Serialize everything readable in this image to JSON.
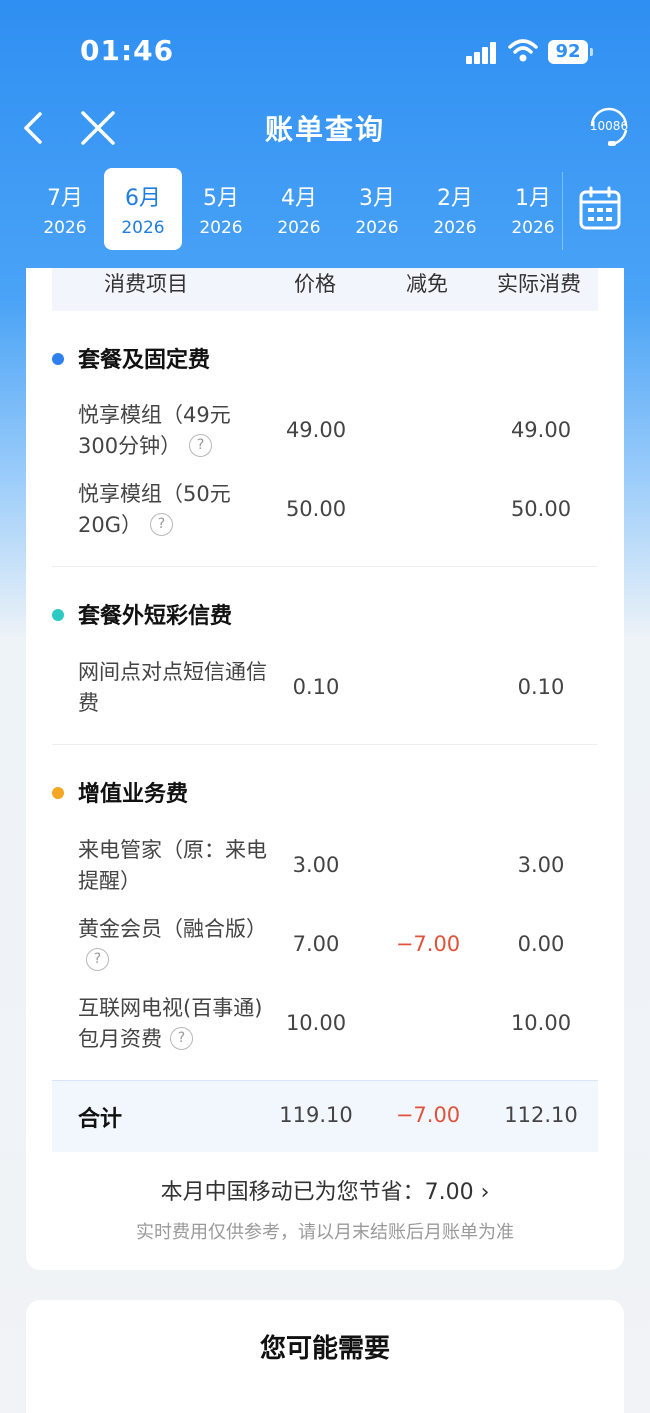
{
  "status_bar": {
    "time": "01:46",
    "battery": "92"
  },
  "header": {
    "title": "账单查询",
    "service_number": "10086"
  },
  "month_tabs": [
    {
      "month": "7月",
      "year": "2026"
    },
    {
      "month": "6月",
      "year": "2026"
    },
    {
      "month": "5月",
      "year": "2026"
    },
    {
      "month": "4月",
      "year": "2026"
    },
    {
      "month": "3月",
      "year": "2026"
    },
    {
      "month": "2月",
      "year": "2026"
    },
    {
      "month": "1月",
      "year": "2026"
    }
  ],
  "table": {
    "headers": {
      "item": "消费项目",
      "price": "价格",
      "discount": "减免",
      "actual": "实际消费"
    },
    "sections": [
      {
        "title": "套餐及固定费",
        "color": "#2f80ed",
        "items": [
          {
            "name": "悦享模组（49元300分钟）",
            "price": "49.00",
            "discount": "",
            "actual": "49.00"
          },
          {
            "name": "悦享模组（50元20G）",
            "price": "50.00",
            "discount": "",
            "actual": "50.00"
          }
        ]
      },
      {
        "title": "套餐外短彩信费",
        "color": "#2ec9c3",
        "items": [
          {
            "name": "网间点对点短信通信费",
            "price": "0.10",
            "discount": "",
            "actual": "0.10"
          }
        ]
      },
      {
        "title": "增值业务费",
        "color": "#f5a623",
        "items": [
          {
            "name": "来电管家（原：来电提醒）",
            "price": "3.00",
            "discount": "",
            "actual": "3.00"
          },
          {
            "name": "黄金会员（融合版）",
            "price": "7.00",
            "discount": "−7.00",
            "actual": "0.00"
          },
          {
            "name": "互联网电视(百事通)包月资费",
            "price": "10.00",
            "discount": "",
            "actual": "10.00"
          }
        ]
      }
    ],
    "total": {
      "label": "合计",
      "price": "119.10",
      "discount": "−7.00",
      "actual": "112.10"
    }
  },
  "savings": {
    "text": "本月中国移动已为您节省：7.00",
    "arrow": "›"
  },
  "note": "实时费用仅供参考，请以月末结账后月账单为准",
  "recommend": {
    "title": "您可能需要"
  },
  "help_mark": "?"
}
